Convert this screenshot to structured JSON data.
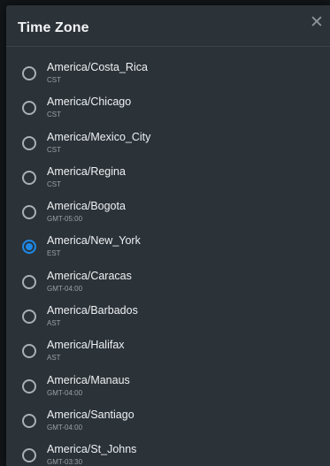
{
  "dialog": {
    "title": "Time Zone",
    "close_icon": "close-icon"
  },
  "timezones": [
    {
      "name": "America/Costa_Rica",
      "abbr": "CST",
      "selected": false
    },
    {
      "name": "America/Chicago",
      "abbr": "CST",
      "selected": false
    },
    {
      "name": "America/Mexico_City",
      "abbr": "CST",
      "selected": false
    },
    {
      "name": "America/Regina",
      "abbr": "CST",
      "selected": false
    },
    {
      "name": "America/Bogota",
      "abbr": "GMT-05:00",
      "selected": false
    },
    {
      "name": "America/New_York",
      "abbr": "EST",
      "selected": true
    },
    {
      "name": "America/Caracas",
      "abbr": "GMT-04:00",
      "selected": false
    },
    {
      "name": "America/Barbados",
      "abbr": "AST",
      "selected": false
    },
    {
      "name": "America/Halifax",
      "abbr": "AST",
      "selected": false
    },
    {
      "name": "America/Manaus",
      "abbr": "GMT-04:00",
      "selected": false
    },
    {
      "name": "America/Santiago",
      "abbr": "GMT-04:00",
      "selected": false
    },
    {
      "name": "America/St_Johns",
      "abbr": "GMT-03:30",
      "selected": false
    }
  ],
  "colors": {
    "accent": "#1e88e5",
    "dialog_bg": "#2b3238"
  }
}
